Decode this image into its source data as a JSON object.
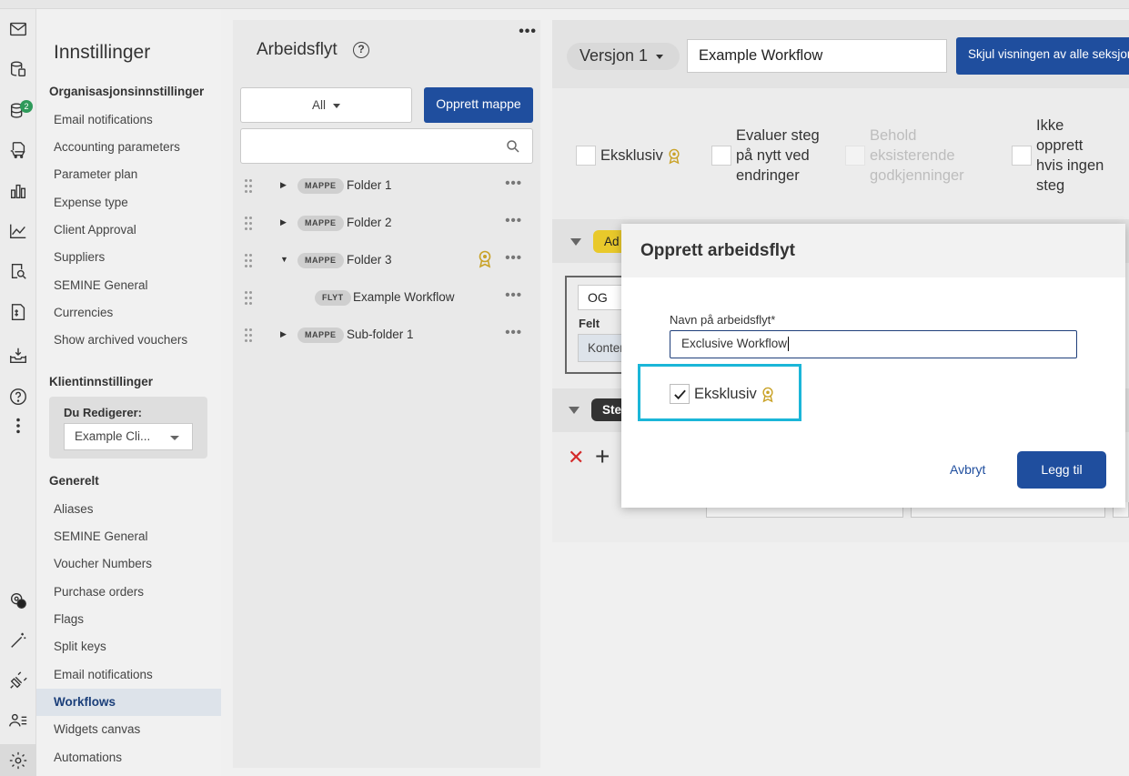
{
  "settings": {
    "title": "Innstillinger",
    "org_header": "Organisasjonsinnstillinger",
    "org_items": [
      "Email notifications",
      "Accounting parameters",
      "Parameter plan",
      "Expense type",
      "Client Approval",
      "Suppliers",
      "SEMINE General",
      "Currencies",
      "Show archived vouchers"
    ],
    "client_header": "Klientinnstillinger",
    "editing_label": "Du Redigerer:",
    "editing_value": "Example Cli...",
    "general_header": "Generelt",
    "general_items": [
      "Aliases",
      "SEMINE General",
      "Voucher Numbers",
      "Purchase orders",
      "Flags",
      "Split keys",
      "Email notifications",
      "Workflows",
      "Widgets canvas",
      "Automations"
    ],
    "active_item": "Workflows"
  },
  "rail": {
    "badge": "2"
  },
  "tree": {
    "title": "Arbeidsflyt",
    "help": "?",
    "filter_label": "All",
    "new_folder_label": "Opprett mappe",
    "search_placeholder": "",
    "rows": [
      {
        "tag": "MAPPE",
        "name": "Folder 1"
      },
      {
        "tag": "MAPPE",
        "name": "Folder 2"
      },
      {
        "tag": "MAPPE",
        "name": "Folder 3"
      },
      {
        "tag": "FLYT",
        "name": "Example Workflow"
      },
      {
        "tag": "MAPPE",
        "name": "Sub-folder 1"
      }
    ]
  },
  "main": {
    "version_label": "Versjon 1",
    "workflow_name": "Example Workflow",
    "hide_button": "Skjul visningen av alle seksjon",
    "opt_exclusive": "Eksklusiv",
    "opt_reevaluate": [
      "Evaluer steg",
      "på nytt ved",
      "endringer"
    ],
    "opt_keep": [
      "Behold",
      "eksisterende",
      "godkjenninger"
    ],
    "opt_nocreate": [
      "Ikke",
      "opprett",
      "hvis ingen",
      "steg"
    ],
    "band1_tag": "Ad",
    "og_label": "OG",
    "felt_label": "Felt",
    "konto_label": "Konter",
    "band2_tag": "Ste"
  },
  "modal": {
    "title": "Opprett arbeidsflyt",
    "field_label": "Navn på arbeidsflyt*",
    "field_value": "Exclusive Workflow",
    "checkbox_label": "Eksklusiv",
    "cancel_label": "Avbryt",
    "add_label": "Legg til"
  },
  "colors": {
    "primary": "#1f4e9e",
    "highlight": "#1bb6d8",
    "badge": "#2e9a5a",
    "award": "#c9a227"
  }
}
